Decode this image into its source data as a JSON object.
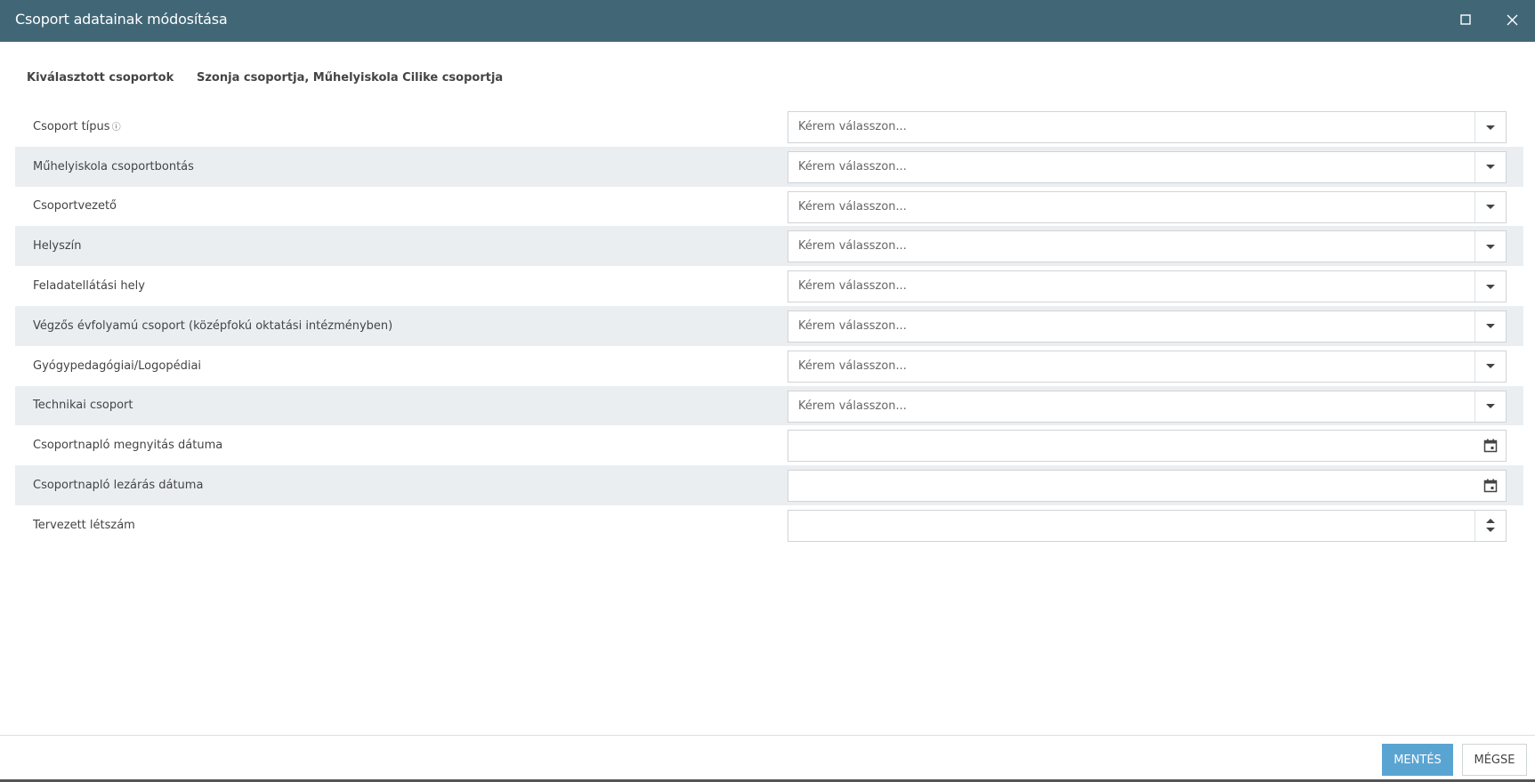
{
  "dialog": {
    "title": "Csoport adatainak módosítása"
  },
  "selected": {
    "label": "Kiválasztott csoportok",
    "value": "Szonja csoportja, Műhelyiskola Cilike csoportja"
  },
  "fields": [
    {
      "label": "Csoport típus",
      "placeholder": "Kérem válasszon...",
      "type": "select",
      "info": "ⓘ"
    },
    {
      "label": "Műhelyiskola csoportbontás",
      "placeholder": "Kérem válasszon...",
      "type": "select"
    },
    {
      "label": "Csoportvezető",
      "placeholder": "Kérem válasszon...",
      "type": "select"
    },
    {
      "label": "Helyszín",
      "placeholder": "Kérem válasszon...",
      "type": "select"
    },
    {
      "label": "Feladatellátási hely",
      "placeholder": "Kérem válasszon...",
      "type": "select"
    },
    {
      "label": "Végzős évfolyamú csoport (középfokú oktatási intézményben)",
      "placeholder": "Kérem válasszon...",
      "type": "select"
    },
    {
      "label": "Gyógypedagógiai/Logopédiai",
      "placeholder": "Kérem válasszon...",
      "type": "select"
    },
    {
      "label": "Technikai csoport",
      "placeholder": "Kérem válasszon...",
      "type": "select"
    },
    {
      "label": "Csoportnapló megnyitás dátuma",
      "value": "",
      "type": "date"
    },
    {
      "label": "Csoportnapló lezárás dátuma",
      "value": "",
      "type": "date"
    },
    {
      "label": "Tervezett létszám",
      "value": "",
      "type": "number"
    }
  ],
  "footer": {
    "save_label": "MENTÉS",
    "cancel_label": "MÉGSE"
  },
  "colors": {
    "titlebar": "#416777",
    "primary_button": "#5aa4d2",
    "alt_row": "#ebeef1"
  },
  "icons": {
    "maximize": "maximize-icon",
    "close": "close-icon",
    "dropdown": "chevron-down-icon",
    "calendar": "calendar-icon",
    "spinner": "spinner-icon",
    "info": "info-icon"
  }
}
